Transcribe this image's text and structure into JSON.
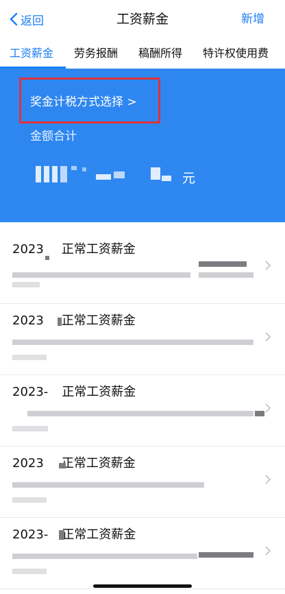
{
  "nav": {
    "back_label": "返回",
    "title": "工资薪金",
    "add_label": "新增"
  },
  "tabs": [
    {
      "label": "工资薪金",
      "active": true
    },
    {
      "label": "劳务报酬",
      "active": false
    },
    {
      "label": "稿酬所得",
      "active": false
    },
    {
      "label": "特许权使用费",
      "active": false
    }
  ],
  "banner": {
    "method_label": "奖金计税方式选择 >",
    "sum_label": "金额合计",
    "amount_unit": "元"
  },
  "records": [
    {
      "year": "2023",
      "type": "正常工资薪金"
    },
    {
      "year": "2023",
      "type": "正常工资薪金"
    },
    {
      "year": "2023-",
      "type": "正常工资薪金"
    },
    {
      "year": "2023",
      "type": "正常工资薪金"
    },
    {
      "year": "2023-",
      "type": "正常工资薪金"
    }
  ],
  "colors": {
    "accent": "#1a7ef5",
    "banner": "#2e86f0",
    "highlight": "#e0323a"
  }
}
